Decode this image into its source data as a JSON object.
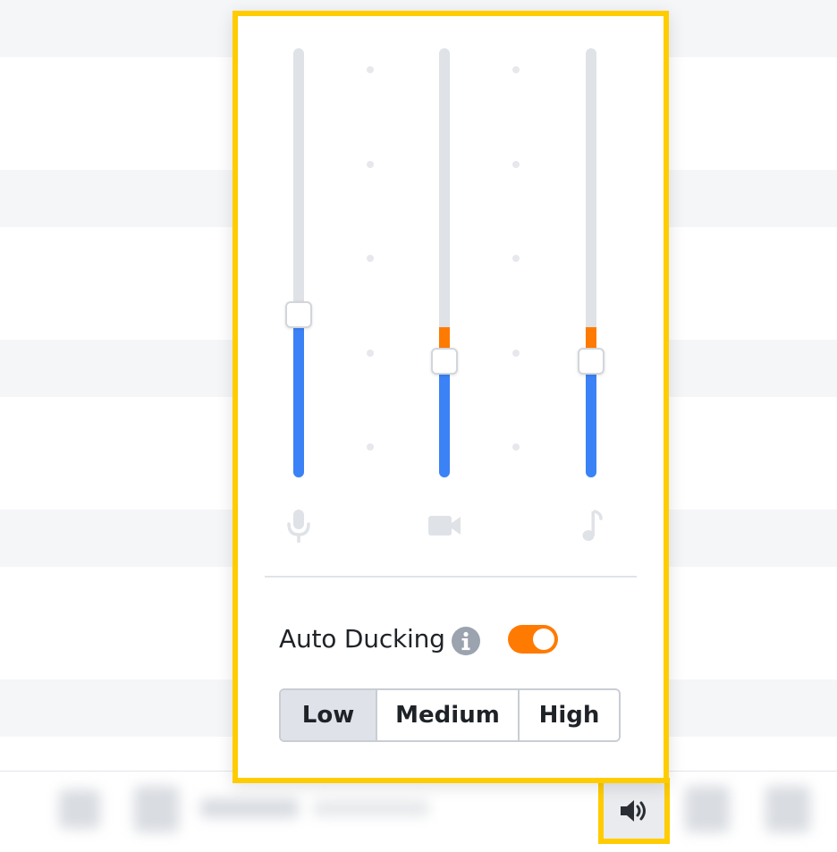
{
  "mixer": {
    "channels": [
      {
        "name": "microphone",
        "icon": "microphone-icon",
        "volume_percent": 38,
        "level_percent": 38
      },
      {
        "name": "video",
        "icon": "video-camera-icon",
        "volume_percent": 27,
        "level_percent": 27,
        "peak_percent": 8
      },
      {
        "name": "music",
        "icon": "music-note-icon",
        "volume_percent": 27,
        "level_percent": 27,
        "peak_percent": 8
      }
    ],
    "auto_ducking": {
      "label": "Auto Ducking",
      "info_icon": "info-icon",
      "enabled": true,
      "levels": [
        "Low",
        "Medium",
        "High"
      ],
      "selected": "Low"
    },
    "accent_color": "#ff7a00",
    "level_color": "#3b82f6",
    "highlight_color": "#ffcc00"
  },
  "toolbar": {
    "volume_icon": "speaker-volume-icon"
  }
}
